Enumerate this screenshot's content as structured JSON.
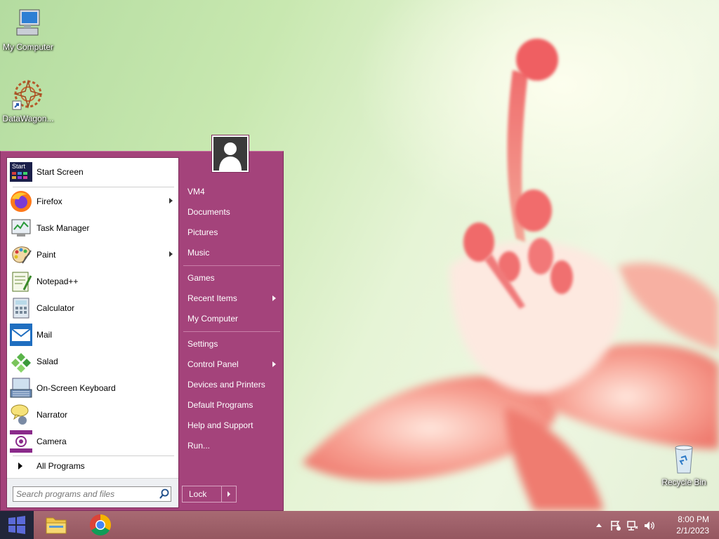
{
  "desktop": {
    "icons": [
      {
        "label": "My Computer",
        "icon": "computer-icon"
      },
      {
        "label": "DataWagon...",
        "icon": "datawagon-icon"
      },
      {
        "label": "Recycle Bin",
        "icon": "recycle-bin-icon"
      }
    ]
  },
  "start_menu": {
    "programs": [
      {
        "label": "Start Screen",
        "icon": "start-screen-icon",
        "submenu": false
      },
      {
        "label": "Firefox",
        "icon": "firefox-icon",
        "submenu": true
      },
      {
        "label": "Task Manager",
        "icon": "task-manager-icon",
        "submenu": false
      },
      {
        "label": "Paint",
        "icon": "paint-icon",
        "submenu": true
      },
      {
        "label": "Notepad++",
        "icon": "notepadpp-icon",
        "submenu": false
      },
      {
        "label": "Calculator",
        "icon": "calculator-icon",
        "submenu": false
      },
      {
        "label": "Mail",
        "icon": "mail-icon",
        "submenu": false
      },
      {
        "label": "Salad",
        "icon": "salad-icon",
        "submenu": false
      },
      {
        "label": "On-Screen Keyboard",
        "icon": "keyboard-icon",
        "submenu": false
      },
      {
        "label": "Narrator",
        "icon": "narrator-icon",
        "submenu": false
      },
      {
        "label": "Camera",
        "icon": "camera-icon",
        "submenu": false
      }
    ],
    "start_screen_icon_text": "Start",
    "all_programs": "All Programs",
    "search_placeholder": "Search programs and files",
    "places": [
      {
        "label": "VM4",
        "submenu": false
      },
      {
        "label": "Documents",
        "submenu": false
      },
      {
        "label": "Pictures",
        "submenu": false
      },
      {
        "label": "Music",
        "submenu": false
      },
      {
        "label": "Games",
        "submenu": false
      },
      {
        "label": "Recent Items",
        "submenu": true
      },
      {
        "label": "My Computer",
        "submenu": false
      },
      {
        "label": "Settings",
        "submenu": false
      },
      {
        "label": "Control Panel",
        "submenu": true
      },
      {
        "label": "Devices and Printers",
        "submenu": false
      },
      {
        "label": "Default Programs",
        "submenu": false
      },
      {
        "label": "Help and Support",
        "submenu": false
      },
      {
        "label": "Run...",
        "submenu": false
      }
    ],
    "lock_label": "Lock"
  },
  "taskbar": {
    "pinned": [
      {
        "name": "file-explorer",
        "icon": "folder-icon"
      },
      {
        "name": "chrome",
        "icon": "chrome-icon"
      }
    ],
    "clock_time": "8:00 PM",
    "clock_date": "2/1/2023"
  },
  "colors": {
    "start_menu_bg": "#a4437b",
    "taskbar_bg": "#9a5d66",
    "start_button_bg": "#21263a"
  }
}
